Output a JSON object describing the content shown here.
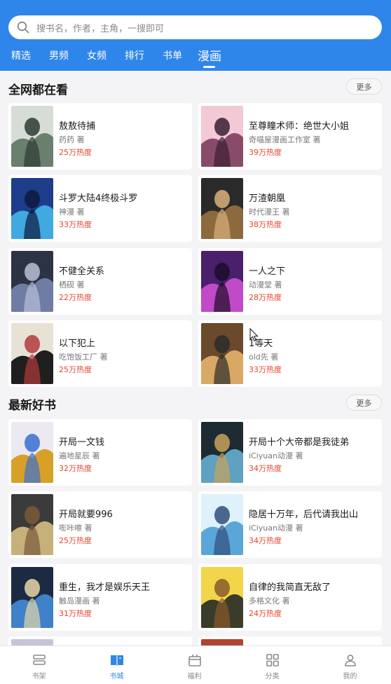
{
  "search": {
    "placeholder": "搜书名，作者，主角，一搜即可"
  },
  "tabs": [
    {
      "label": "精选",
      "active": false
    },
    {
      "label": "男频",
      "active": false
    },
    {
      "label": "女频",
      "active": false
    },
    {
      "label": "排行",
      "active": false
    },
    {
      "label": "书单",
      "active": false
    },
    {
      "label": "漫画",
      "active": true
    }
  ],
  "sections": [
    {
      "title": "全网都在看",
      "more_label": "更多",
      "books": [
        {
          "title": "敖敖待捕",
          "author": "药药 著",
          "heat": "25万热度"
        },
        {
          "title": "至尊瞳术师：绝世大小姐",
          "author": "奇喵屋漫画工作室 著",
          "heat": "39万热度"
        },
        {
          "title": "斗罗大陆4终极斗罗",
          "author": "神漫 著",
          "heat": "33万热度"
        },
        {
          "title": "万渣朝凰",
          "author": "时代漫王 著",
          "heat": "38万热度"
        },
        {
          "title": "不健全关系",
          "author": "栖砚 著",
          "heat": "22万热度"
        },
        {
          "title": "一人之下",
          "author": "动漫堂 著",
          "heat": "28万热度"
        },
        {
          "title": "以下犯上",
          "author": "吃饱饭工厂 著",
          "heat": "25万热度"
        },
        {
          "title": "1等天",
          "author": "old先 著",
          "heat": "33万热度"
        }
      ]
    },
    {
      "title": "最新好书",
      "more_label": "更多",
      "books": [
        {
          "title": "开局一文钱",
          "author": "遍地星辰 著",
          "heat": "32万热度"
        },
        {
          "title": "开局十个大帝都是我徒弟",
          "author": "iCiyuan动漫 著",
          "heat": "34万热度"
        },
        {
          "title": "开局就要996",
          "author": "嘭咔嚓 著",
          "heat": "25万热度"
        },
        {
          "title": "隐居十万年，后代请我出山",
          "author": "iCiyuan动漫 著",
          "heat": "34万热度"
        },
        {
          "title": "重生，我才是娱乐天王",
          "author": "触岛漫画 著",
          "heat": "31万热度"
        },
        {
          "title": "自律的我简直无敌了",
          "author": "多格文化 著",
          "heat": "24万热度"
        }
      ]
    }
  ],
  "bottom_nav": [
    {
      "label": "书架",
      "icon": "bookshelf-icon",
      "active": false
    },
    {
      "label": "书城",
      "icon": "bookstore-icon",
      "active": true
    },
    {
      "label": "福利",
      "icon": "gift-icon",
      "active": false
    },
    {
      "label": "分类",
      "icon": "category-icon",
      "active": false
    },
    {
      "label": "我的",
      "icon": "profile-icon",
      "active": false
    }
  ],
  "colors": {
    "primary": "#2f86ea",
    "heat": "#e8442e",
    "background": "#f4f4f6"
  }
}
